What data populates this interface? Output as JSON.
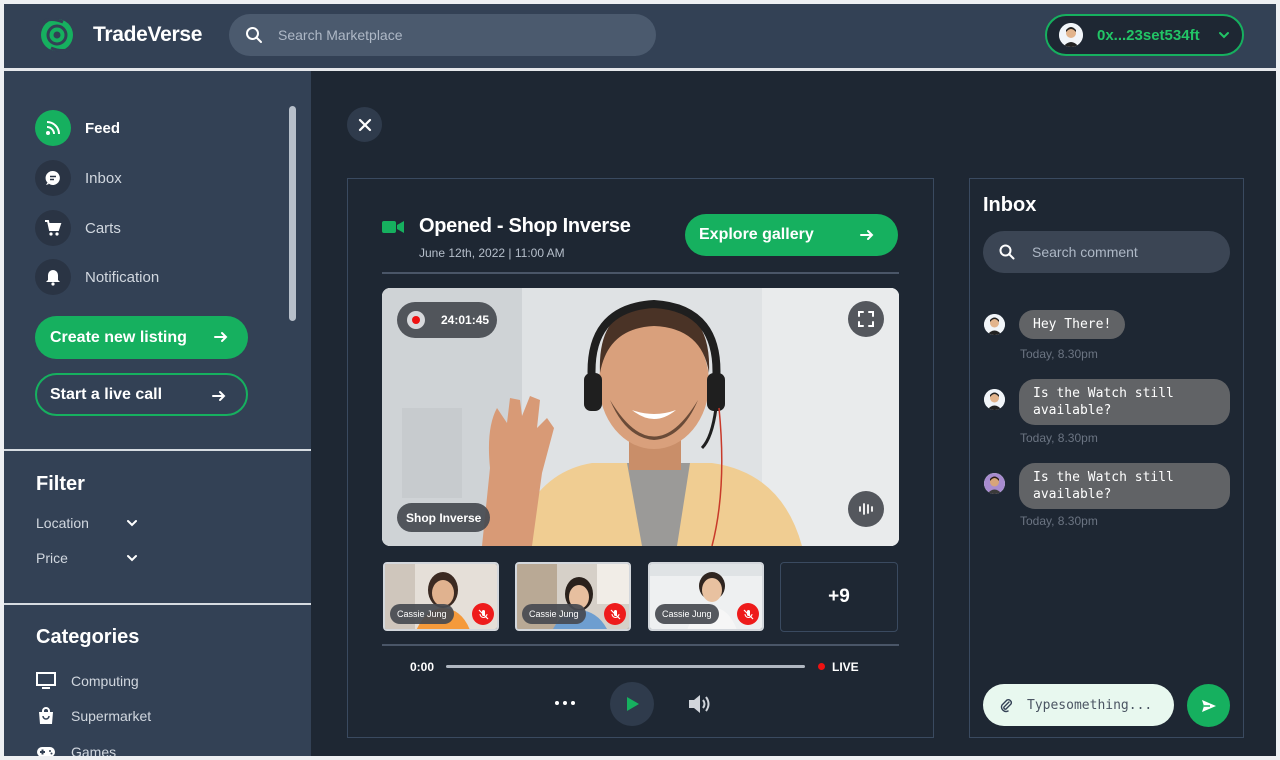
{
  "app": {
    "brand": "TradeVerse",
    "accent": "#16b05f"
  },
  "header": {
    "search_placeholder": "Search Marketplace",
    "wallet_address": "0x...23set534ft"
  },
  "sidebar": {
    "nav": [
      {
        "label": "Feed",
        "icon": "rss-icon",
        "active": true
      },
      {
        "label": "Inbox",
        "icon": "chat-icon",
        "active": false
      },
      {
        "label": "Carts",
        "icon": "cart-icon",
        "active": false
      },
      {
        "label": "Notification",
        "icon": "bell-icon",
        "active": false
      }
    ],
    "create_listing": "Create new listing",
    "start_call": "Start a live call",
    "filter_title": "Filter",
    "filters": [
      "Location",
      "Price"
    ],
    "categories_title": "Categories",
    "categories": [
      {
        "label": "Computing",
        "icon": "monitor-icon"
      },
      {
        "label": "Supermarket",
        "icon": "shopping-bag-icon"
      },
      {
        "label": "Games",
        "icon": "gamepad-icon"
      }
    ]
  },
  "stream": {
    "title": "Opened - Shop Inverse",
    "date": "June 12th, 2022 | 11:00 AM",
    "explore_label": "Explore gallery",
    "rec_time": "24:01:45",
    "host_label": "Shop Inverse",
    "participants": [
      {
        "name": "Cassie Jung"
      },
      {
        "name": "Cassie Jung"
      },
      {
        "name": "Cassie Jung"
      }
    ],
    "more_count": "+9",
    "time_current": "0:00",
    "live_label": "LIVE",
    "progress": 0
  },
  "inbox": {
    "title": "Inbox",
    "search_placeholder": "Search comment",
    "messages": [
      {
        "text": "Hey There!",
        "time": "Today, 8.30pm"
      },
      {
        "text": "Is the Watch still available?",
        "time": "Today, 8.30pm"
      },
      {
        "text": "Is the Watch still available?",
        "time": "Today, 8.30pm"
      }
    ],
    "type_placeholder": "Typesomething..."
  }
}
